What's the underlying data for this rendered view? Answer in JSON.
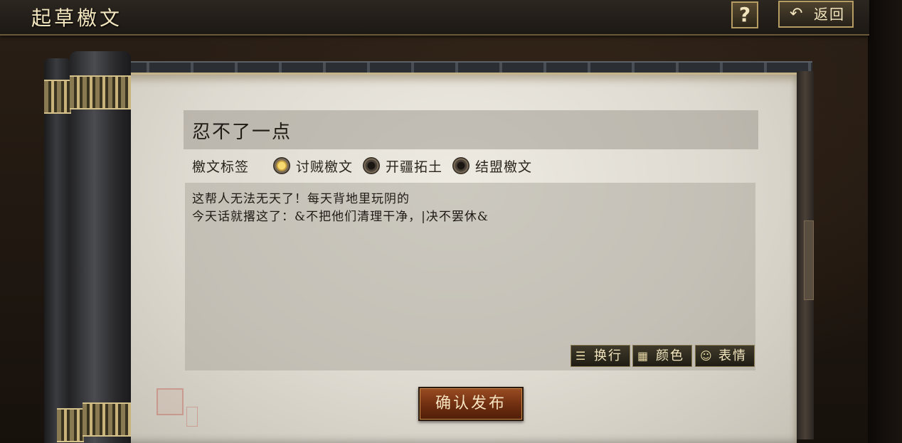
{
  "header": {
    "title": "起草檄文",
    "help_label": "?",
    "back_label": "返回",
    "back_icon": "undo-arrow-icon"
  },
  "form": {
    "title_value": "忍不了一点",
    "tag_label": "檄文标签",
    "tags": [
      {
        "label": "讨贼檄文",
        "selected": true
      },
      {
        "label": "开疆拓土",
        "selected": false
      },
      {
        "label": "结盟檄文",
        "selected": false
      }
    ],
    "content_lines": [
      "这帮人无法无天了！每天背地里玩阴的",
      "今天话就撂这了：&不把他们清理干净，|决不罢休&"
    ],
    "tools": [
      {
        "label": "换行",
        "icon": "line-break-icon"
      },
      {
        "label": "颜色",
        "icon": "color-grid-icon"
      },
      {
        "label": "表情",
        "icon": "smiley-icon"
      }
    ],
    "confirm_label": "确认发布"
  },
  "colors": {
    "accent_gold": "#b59c62",
    "confirm_red": "#7a3414",
    "radio_selected": "#f6d970"
  }
}
